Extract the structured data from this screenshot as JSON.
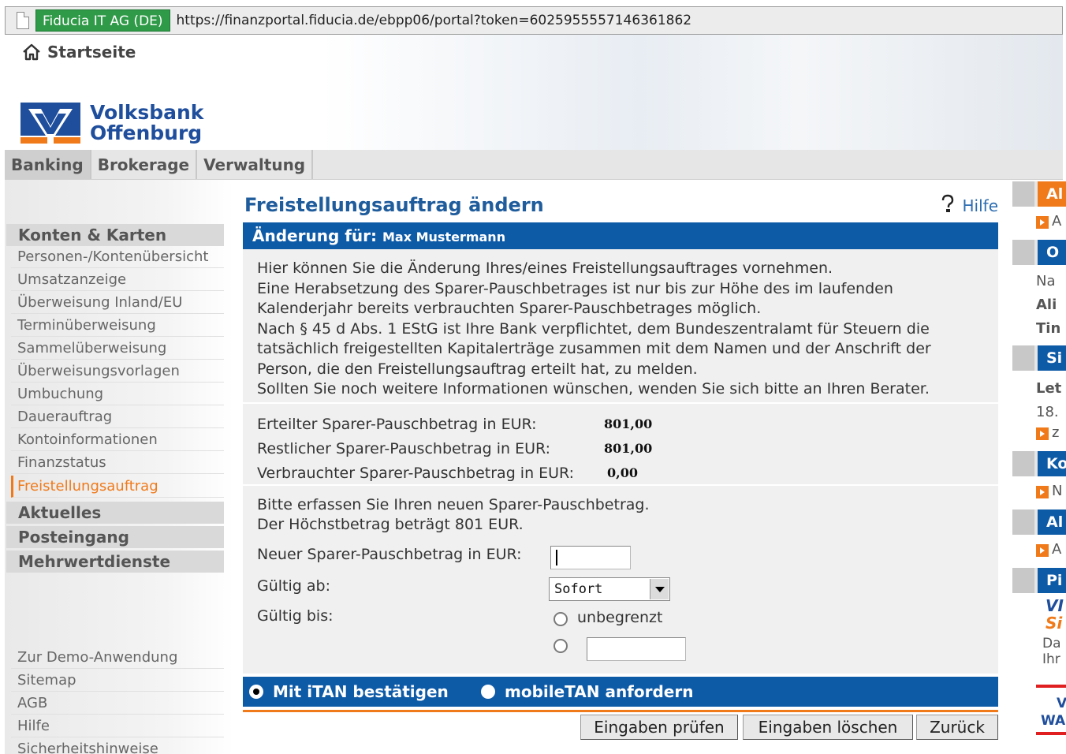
{
  "browser": {
    "site_identity": "Fiducia IT AG (DE)",
    "url": "https://finanzportal.fiducia.de/ebpp06/portal?token=6025955557146361862"
  },
  "header": {
    "home_label": "Startseite",
    "bank_name_line1": "Volksbank",
    "bank_name_line2": "Offenburg"
  },
  "topnav": {
    "tabs": [
      {
        "label": "Banking"
      },
      {
        "label": "Brokerage"
      },
      {
        "label": "Verwaltung"
      }
    ]
  },
  "sidebar": {
    "section_konten": "Konten & Karten",
    "items": [
      {
        "label": "Personen-/Kontenübersicht"
      },
      {
        "label": "Umsatzanzeige"
      },
      {
        "label": "Überweisung Inland/EU"
      },
      {
        "label": "Terminüberweisung"
      },
      {
        "label": "Sammelüberweisung"
      },
      {
        "label": "Überweisungsvorlagen"
      },
      {
        "label": "Umbuchung"
      },
      {
        "label": "Dauerauftrag"
      },
      {
        "label": "Kontoinformationen"
      },
      {
        "label": "Finanzstatus"
      },
      {
        "label": "Freistellungsauftrag"
      }
    ],
    "section_aktuelles": "Aktuelles",
    "section_posteingang": "Posteingang",
    "section_mehrwert": "Mehrwertdienste",
    "footer_items": [
      {
        "label": "Zur Demo-Anwendung"
      },
      {
        "label": "Sitemap"
      },
      {
        "label": "AGB"
      },
      {
        "label": "Hilfe"
      },
      {
        "label": "Sicherheitshinweise"
      }
    ]
  },
  "main": {
    "title": "Freistellungsauftrag ändern",
    "help_label": "Hilfe",
    "change_for_label": "Änderung für:",
    "change_for_name": "Max Mustermann",
    "info_lines": [
      "Hier können Sie die Änderung Ihres/eines Freistellungsauftrages vornehmen.",
      "Eine Herabsetzung des Sparer-Pauschbetrages ist nur bis zur Höhe des im laufenden",
      "Kalenderjahr bereits verbrauchten Sparer-Pauschbetrages möglich.",
      "Nach § 45 d Abs. 1 EStG ist Ihre Bank verpflichtet, dem Bundeszentralamt für Steuern die",
      "tatsächlich freigestellten Kapitalerträge zusammen mit dem Namen und der Anschrift der",
      "Person, die den Freistellungsauftrag erteilt hat, zu melden.",
      "Sollten Sie noch weitere Informationen wünschen, wenden Sie sich bitte an Ihren Berater."
    ],
    "amounts": {
      "granted_label": "Erteilter Sparer-Pauschbetrag in EUR:",
      "granted_value": "801,00",
      "remaining_label": "Restlicher Sparer-Pauschbetrag in EUR:",
      "remaining_value": "801,00",
      "used_label": "Verbrauchter Sparer-Pauschbetrag in EUR:",
      "used_value": "0,00"
    },
    "form": {
      "intro_line1": "Bitte erfassen Sie Ihren neuen Sparer-Pauschbetrag.",
      "intro_line2": "Der Höchstbetrag beträgt 801 EUR.",
      "new_amount_label": "Neuer Sparer-Pauschbetrag in EUR:",
      "new_amount_value": "",
      "valid_from_label": "Gültig ab:",
      "valid_from_value": "Sofort",
      "valid_until_label": "Gültig bis:",
      "unlimited_label": "unbegrenzt",
      "valid_until_date_value": ""
    },
    "tan": {
      "itan_label": "Mit iTAN bestätigen",
      "mobiletan_label": "mobileTAN anfordern"
    },
    "buttons": {
      "check": "Eingaben prüfen",
      "clear": "Eingaben löschen",
      "back": "Zurück"
    }
  },
  "rightcol": {
    "box1_title": "Al",
    "box1_link": "A",
    "box2_title": "O",
    "box2_lines": [
      "Na",
      "Ali",
      "Tin"
    ],
    "box3_title": "Si",
    "box3_lines": [
      "Let",
      "18."
    ],
    "box3_link": "z",
    "box4_title": "Ko",
    "box4_link": "N",
    "box5_title": "Al",
    "box5_link": "A",
    "box6_title": "Pi",
    "promo_line1": "VI",
    "promo_line2": "Si",
    "promo_text1": "Da",
    "promo_text2": "Ihr",
    "promo_line3": "V",
    "promo_line4": "WA"
  },
  "colors": {
    "accent_blue": "#0d5aa7",
    "accent_orange": "#f07a1a",
    "title_blue": "#1f5c9c"
  }
}
